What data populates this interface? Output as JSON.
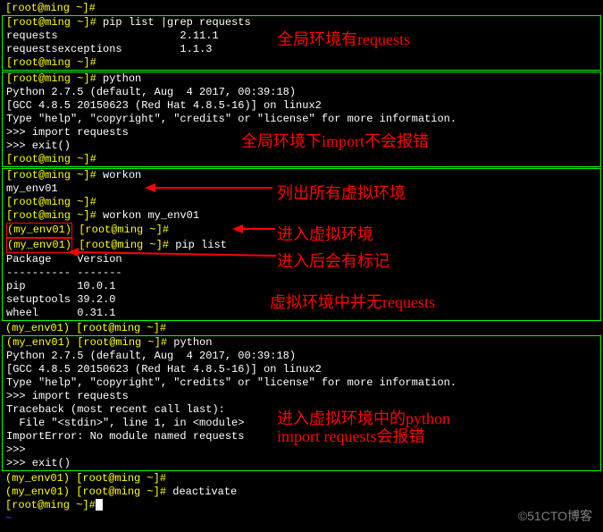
{
  "block1": {
    "prompt_line": "[root@ming ~]#",
    "blank_prompt": "[root@ming ~]# ",
    "cmd": "pip list |grep requests",
    "row1": "requests                   2.11.1",
    "row2": "requestsexceptions         1.1.3"
  },
  "block2": {
    "cmd": "python",
    "l1": "Python 2.7.5 (default, Aug  4 2017, 00:39:18)",
    "l2": "[GCC 4.8.5 20150623 (Red Hat 4.8.5-16)] on linux2",
    "l3": "Type \"help\", \"copyright\", \"credits\" or \"license\" for more information.",
    "imp": ">>> import requests",
    "exit": ">>> exit()",
    "prompt": "[root@ming ~]#"
  },
  "block3": {
    "prompt": "[root@ming ~]#",
    "cmd_workon": "workon",
    "env_name": "my_env01",
    "cmd_workon_env": "workon my_env01",
    "venv_prefix": "(my_env01)",
    "venv_prompt": " [root@ming ~]#",
    "cmd_piplist": "pip list",
    "header": "Package    Version",
    "dashes": "---------- -------",
    "pkg1": "pip        10.0.1",
    "pkg2": "setuptools 39.2.0",
    "pkg3": "wheel      0.31.1"
  },
  "block4": {
    "venv_prefix": "(my_env01)",
    "prompt": " [root@ming ~]#",
    "cmd": "python",
    "l1": "Python 2.7.5 (default, Aug  4 2017, 00:39:18)",
    "l2": "[GCC 4.8.5 20150623 (Red Hat 4.8.5-16)] on linux2",
    "l3": "Type \"help\", \"copyright\", \"credits\" or \"license\" for more information.",
    "imp": ">>> import requests",
    "tb1": "Traceback (most recent call last):",
    "tb2": "  File \"<stdin>\", line 1, in <module>",
    "tb3": "ImportError: No module named requests",
    "blank": ">>> ",
    "exit": ">>> exit()"
  },
  "block5": {
    "venv_prefix": "(my_env01)",
    "prompt": " [root@ming ~]#",
    "cmd_deact": "deactivate",
    "final_prompt": "[root@ming ~]#"
  },
  "annotations": {
    "a1": "全局环境有requests",
    "a2": "全局环境下import不会报错",
    "a3": "列出所有虚拟环境",
    "a4": "进入虚拟环境",
    "a5": "进入后会有标记",
    "a6": "虚拟环境中并无requests",
    "a7a": "进入虚拟环境中的python",
    "a7b": "import requests会报错"
  },
  "watermark": "©51CTO博客"
}
